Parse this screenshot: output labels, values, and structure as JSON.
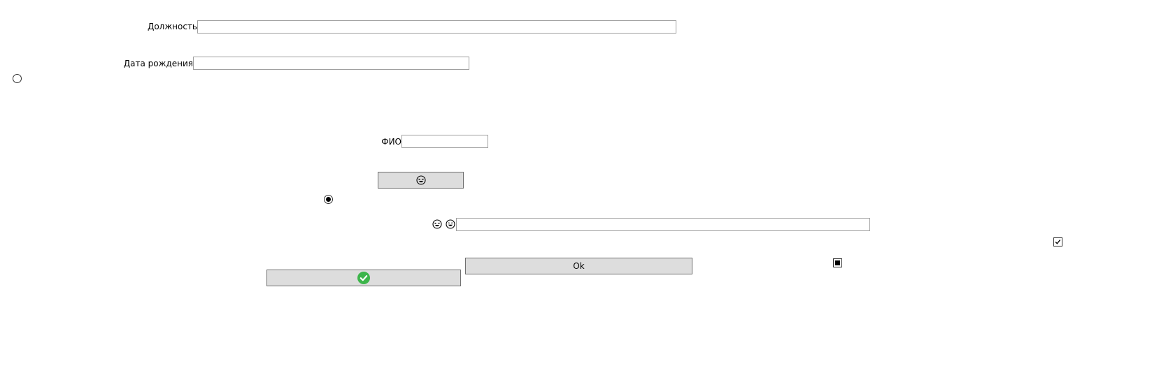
{
  "form": {
    "position_label": "Должность",
    "position_value": "",
    "birthdate_label": "Дата рождения",
    "birthdate_value": "",
    "fio_label": "ФИО",
    "fio_value": "",
    "emoji_field_value": "",
    "ok_label": "Ok"
  },
  "controls": {
    "radio_left_checked": false,
    "radio_middle_checked": true,
    "checkbox_right_checked": true,
    "checkbox_indeterminate": true
  },
  "icons": {
    "emoji_button_icon": "laughing-face-icon",
    "emoji_label_icon_1": "laughing-face-icon",
    "emoji_label_icon_2": "grinning-face-icon",
    "confirm_icon": "green-check-icon",
    "confirm_icon_color": "#3cb54a"
  }
}
